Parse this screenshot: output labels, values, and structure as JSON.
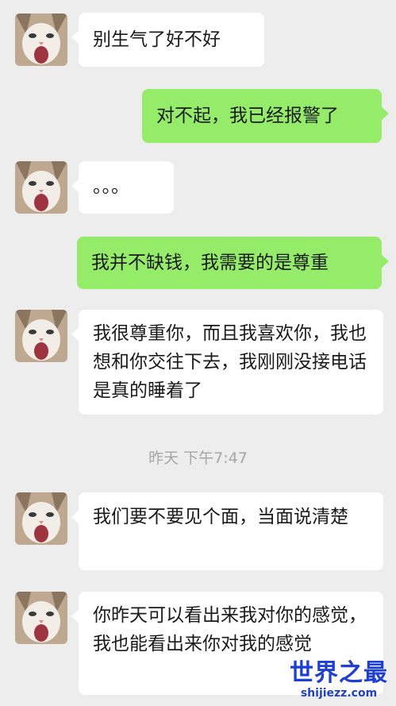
{
  "messages": [
    {
      "side": "in",
      "text": "别生气了好不好",
      "avatar": "cat-avatar"
    },
    {
      "side": "out",
      "text": "对不起，我已经报警了"
    },
    {
      "side": "in",
      "text": "。。。",
      "avatar": "cat-avatar"
    },
    {
      "side": "out",
      "text": "我并不缺钱，我需要的是尊重"
    },
    {
      "side": "in",
      "text": "我很尊重你，而且我喜欢你，我也想和你交往下去，我刚刚没接电话是真的睡着了",
      "avatar": "cat-avatar"
    },
    {
      "side": "in",
      "text": "我们要不要见个面，当面说清楚",
      "avatar": "cat-avatar"
    },
    {
      "side": "in",
      "text": "你昨天可以看出来我对你的感觉，我也能看出来你对我的感觉",
      "avatar": "cat-avatar"
    }
  ],
  "timestamp": "昨天 下午7:47",
  "watermark": {
    "title": "世界之最",
    "url": "shijiezz.com"
  },
  "colors": {
    "background": "#ededed",
    "incoming_bubble": "#ffffff",
    "outgoing_bubble": "#95ec69",
    "watermark": "#1d3fd6"
  }
}
